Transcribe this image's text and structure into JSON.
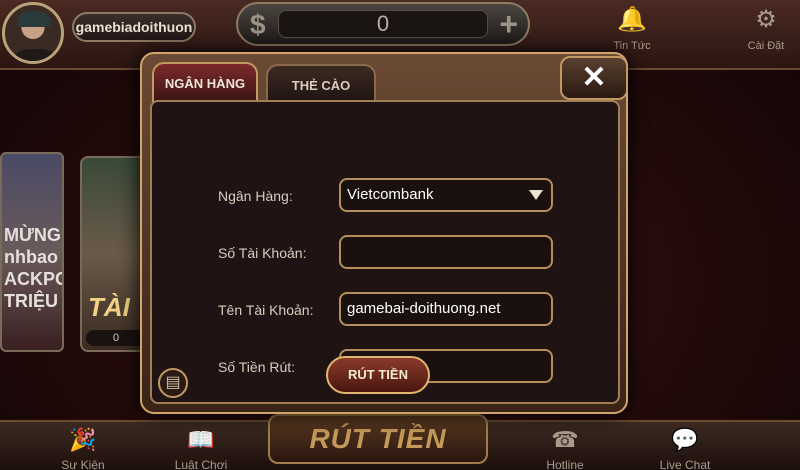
{
  "topbar": {
    "username": "gamebiadoithuon",
    "currency_symbol": "$",
    "balance": "0",
    "add_symbol": "+",
    "news_label": "Tin Tức",
    "settings_label": "Cài Đặt"
  },
  "banners": {
    "left_lines": [
      "MỪNG",
      "nhbao",
      "ACKPOT",
      "TRIỆU"
    ],
    "tai_label": "TÀI",
    "tai_value": "0"
  },
  "modal": {
    "tabs": [
      {
        "label": "NGÂN HÀNG",
        "active": true
      },
      {
        "label": "THẺ CÀO",
        "active": false
      }
    ],
    "close_symbol": "✕",
    "fields": [
      {
        "label": "Ngân Hàng:",
        "value": "Vietcombank",
        "type": "select"
      },
      {
        "label": "Số Tài Khoản:",
        "value": "",
        "type": "text"
      },
      {
        "label": "Tên Tài Khoản:",
        "value": "gamebai-doithuong.net",
        "type": "text"
      },
      {
        "label": "Số Tiền Rút:",
        "value": "",
        "type": "text"
      }
    ],
    "submit_label": "RÚT TIỀN"
  },
  "bottombar": {
    "items": [
      {
        "label": "Sự Kiện",
        "icon": "party-popper-icon"
      },
      {
        "label": "Luật Chơi",
        "icon": "rules-book-icon"
      },
      {
        "label": "Hotline",
        "icon": "phone-icon"
      },
      {
        "label": "Live Chat",
        "icon": "chat-bubble-icon"
      }
    ],
    "center_title": "RÚT TIỀN"
  },
  "colors": {
    "accent_gold": "#d0a56a",
    "tab_active": "#7c2a2a",
    "panel_bg": "#1f1413"
  }
}
